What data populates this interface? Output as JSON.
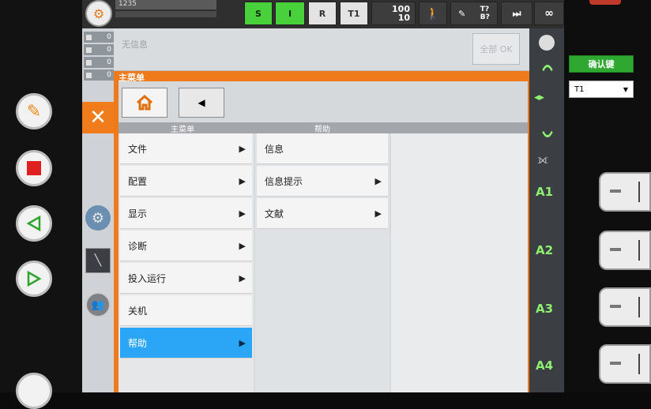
{
  "status_bar": {
    "program_number": "1235",
    "s_label": "S",
    "i_label": "I",
    "r_label": "R",
    "mode_label": "T1",
    "override_top": "100",
    "override_bottom": "10",
    "tool_top": "T?",
    "tool_bottom": "B?",
    "infinity": "∞"
  },
  "message_area": {
    "text": "无信息",
    "all_ok_label": "全部 OK"
  },
  "counters": [
    {
      "value": "0"
    },
    {
      "value": "0"
    },
    {
      "value": "0"
    },
    {
      "value": "0"
    }
  ],
  "menu": {
    "title": "主菜单",
    "col1_header": "主菜单",
    "col2_header": "帮助",
    "main_items": [
      {
        "label": "文件",
        "has_arrow": true
      },
      {
        "label": "配置",
        "has_arrow": true
      },
      {
        "label": "显示",
        "has_arrow": true
      },
      {
        "label": "诊断",
        "has_arrow": true
      },
      {
        "label": "投入运行",
        "has_arrow": true
      },
      {
        "label": "关机",
        "has_arrow": false
      },
      {
        "label": "帮助",
        "has_arrow": true,
        "selected": true
      }
    ],
    "help_items": [
      {
        "label": "信息",
        "has_arrow": false
      },
      {
        "label": "信息提示",
        "has_arrow": true
      },
      {
        "label": "文献",
        "has_arrow": true
      }
    ]
  },
  "right_panel": {
    "confirm_label": "确认键",
    "mode_select": "T1"
  },
  "axes": [
    "A1",
    "A2",
    "A3",
    "A4"
  ],
  "colors": {
    "accent_orange": "#ef7a1c",
    "selected_blue": "#2ba6f6",
    "green": "#47d43b",
    "axis_green": "#8ef06f"
  }
}
